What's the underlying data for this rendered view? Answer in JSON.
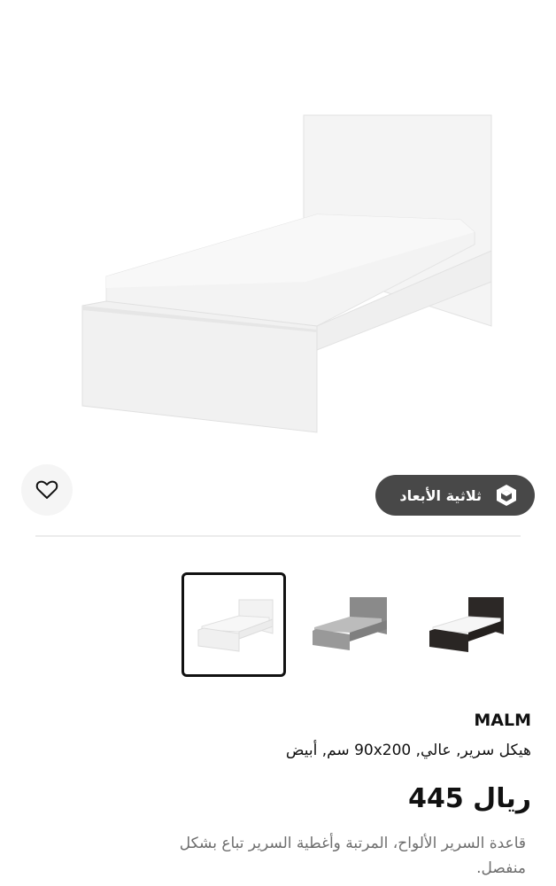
{
  "product": {
    "name": "MALM",
    "description": "هيكل سرير, عالي, 90x200 سم, أبيض",
    "price": "ريال 445",
    "long_description": "قاعدة السرير الألواح، المرتبة وأغطية السرير تباع بشكل منفصل."
  },
  "actions": {
    "view_3d_label": "ثلاثية الأبعاد",
    "favorite_icon": "heart-icon",
    "view_3d_icon": "cube-icon"
  },
  "variants": [
    {
      "color": "white",
      "selected": true
    },
    {
      "color": "gray",
      "selected": false
    },
    {
      "color": "black-brown",
      "selected": false
    }
  ],
  "colors": {
    "button_dark": "#484848",
    "text_secondary": "#6e6e6e"
  }
}
